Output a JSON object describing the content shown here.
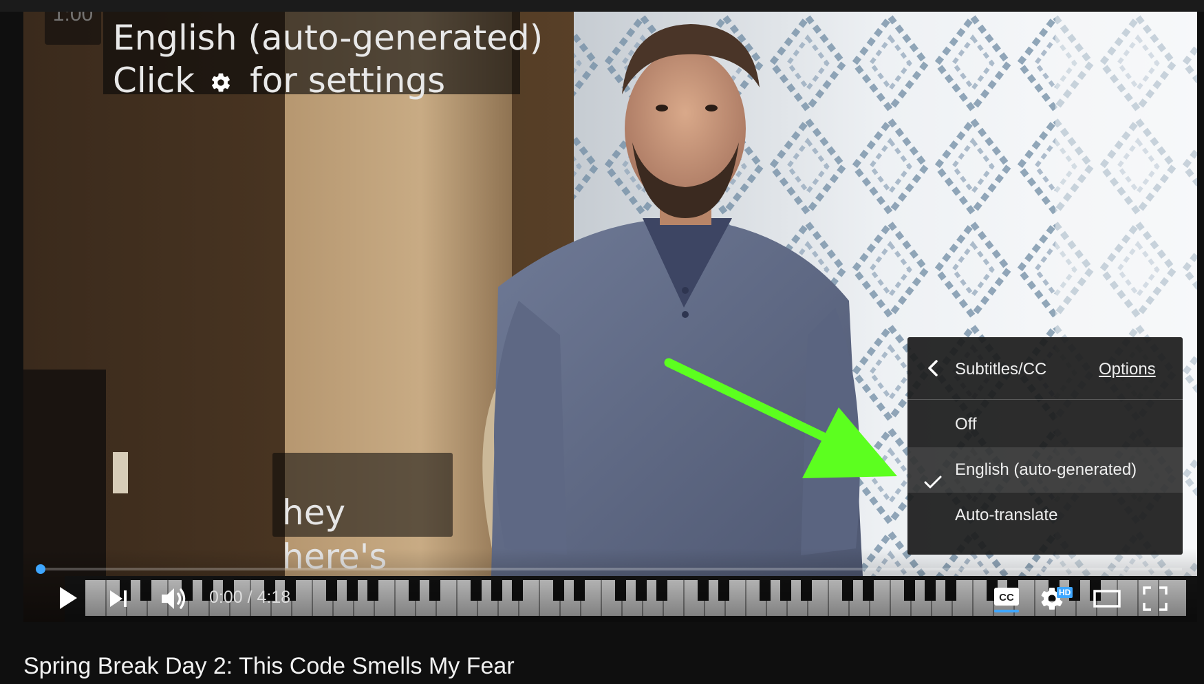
{
  "captions": {
    "stale_time": "1:00",
    "header_line1": "English (auto-generated)",
    "header_line2_prefix": "Click",
    "header_line2_suffix": "for settings",
    "header_icon": "gear-icon",
    "current_text": "hey here's"
  },
  "settings_menu": {
    "back_icon": "chevron-left-icon",
    "title": "Subtitles/CC",
    "options_link": "Options",
    "items": [
      {
        "label": "Off",
        "selected": false
      },
      {
        "label": "English (auto-generated)",
        "selected": true
      },
      {
        "label": "Auto-translate",
        "selected": false
      }
    ],
    "check_icon": "checkmark-icon"
  },
  "annotation": {
    "arrow_color": "#5cff1f"
  },
  "player": {
    "current_time": "0:00",
    "duration": "4:18",
    "time_display": "0:00 / 4:18",
    "progress": 0,
    "accent_color": "#3ea6ff",
    "hd_badge": "HD",
    "controls": {
      "play": "play-icon",
      "next": "next-icon",
      "volume": "volume-icon",
      "captions": "cc-icon",
      "settings": "gear-icon",
      "theater": "theater-mode-icon",
      "fullscreen": "fullscreen-icon"
    }
  },
  "video": {
    "title": "Spring Break Day 2: This Code Smells My Fear"
  }
}
